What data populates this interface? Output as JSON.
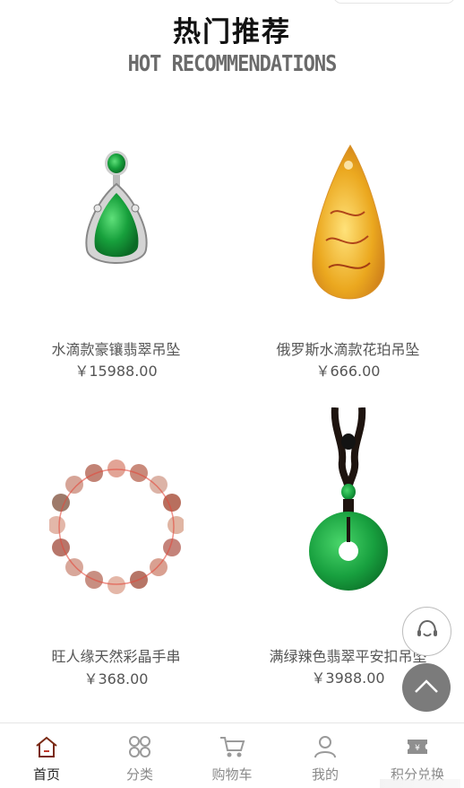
{
  "section": {
    "title_cn": "热门推荐",
    "title_en": "HOT RECOMMENDATIONS"
  },
  "products": [
    {
      "name": "水滴款豪镶翡翠吊坠",
      "price": "￥15988.00",
      "icon": "jade-teardrop-pendant"
    },
    {
      "name": "俄罗斯水滴款花珀吊坠",
      "price": "￥666.00",
      "icon": "amber-teardrop-pendant"
    },
    {
      "name": "旺人缘天然彩晶手串",
      "price": "￥368.00",
      "icon": "crystal-bead-bracelet"
    },
    {
      "name": "满绿辣色翡翠平安扣吊坠",
      "price": "￥3988.00",
      "icon": "jade-donut-pendant"
    }
  ],
  "floating": {
    "service_icon": "customer-service-icon",
    "top_icon": "chevron-up-icon"
  },
  "tabbar": {
    "items": [
      {
        "label": "首页",
        "icon": "home-icon",
        "active": true
      },
      {
        "label": "分类",
        "icon": "category-icon",
        "active": false
      },
      {
        "label": "购物车",
        "icon": "cart-icon",
        "active": false
      },
      {
        "label": "我的",
        "icon": "user-icon",
        "active": false
      },
      {
        "label": "积分兑换",
        "icon": "points-ticket-icon",
        "active": false
      }
    ]
  },
  "colors": {
    "jade": "#1f9e45",
    "amber": "#e6a21c",
    "active_tab": "#222222",
    "inactive_tab": "#8a8a8a",
    "top_button": "#7b7b7b"
  }
}
